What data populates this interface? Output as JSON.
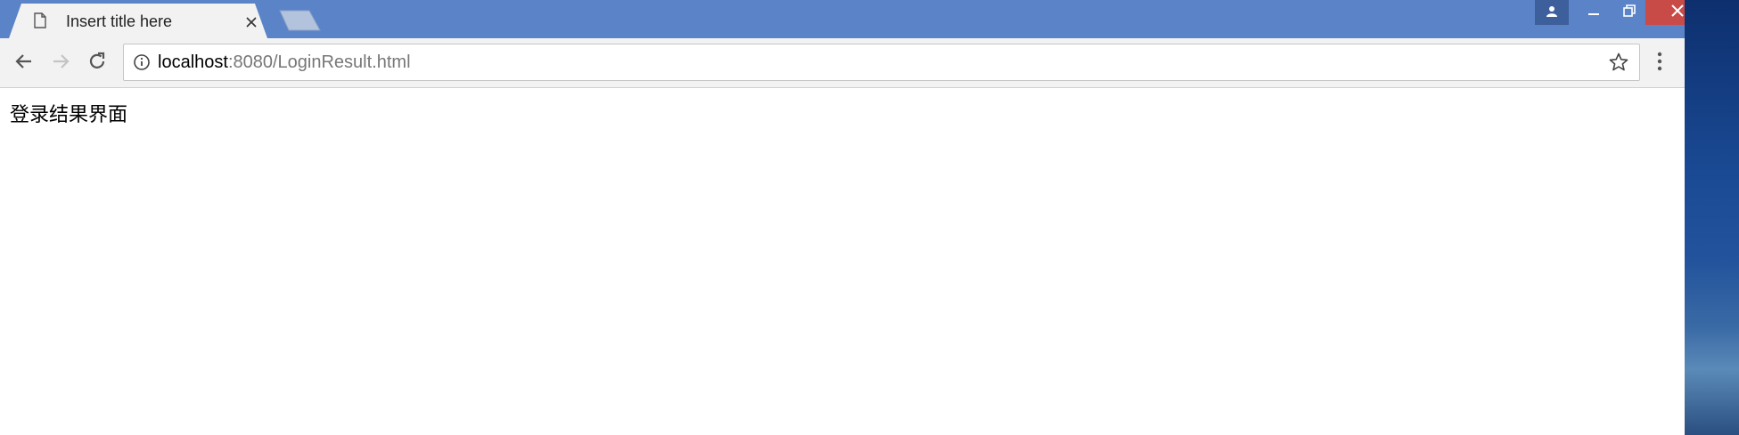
{
  "tab": {
    "title": "Insert title here"
  },
  "address_bar": {
    "host": "localhost",
    "path": ":8080/LoginResult.html"
  },
  "page": {
    "heading": "登录结果界面"
  },
  "colors": {
    "titlebar": "#5b84c8",
    "close_button": "#c94b48",
    "toolbar": "#f2f2f2"
  },
  "icons": {
    "tab": "document-icon",
    "tab_close": "close-icon",
    "new_tab": "new-tab-icon",
    "profile": "person-icon",
    "minimize": "minimize-icon",
    "maximize": "restore-icon",
    "close": "close-icon",
    "back": "arrow-left-icon",
    "forward": "arrow-right-icon",
    "reload": "reload-icon",
    "site_info": "info-icon",
    "bookmark": "star-icon",
    "menu": "kebab-menu-icon"
  }
}
